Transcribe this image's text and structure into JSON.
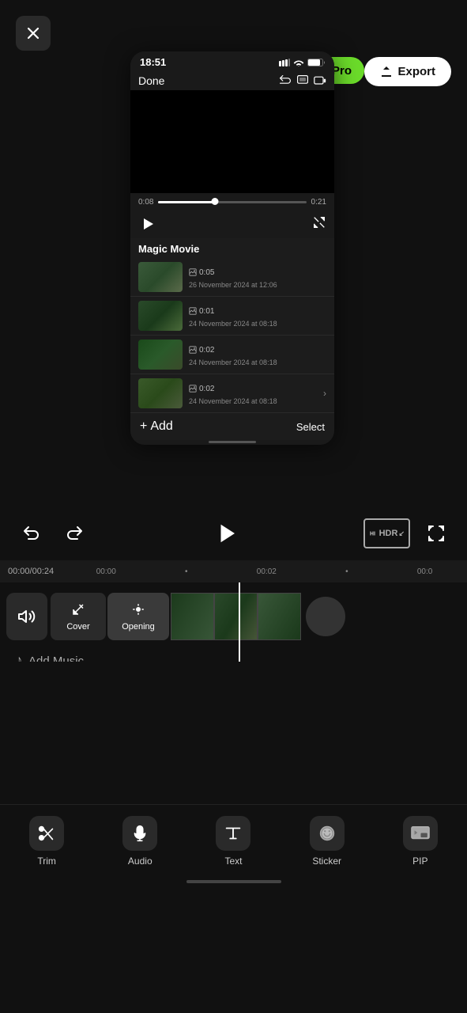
{
  "app": {
    "background": "#111111"
  },
  "close_button": {
    "icon": "✕"
  },
  "export_button": {
    "label": "Export",
    "icon": "↑"
  },
  "pro_badge": {
    "label": "Pro",
    "icon": "◆"
  },
  "phone": {
    "time": "18:51",
    "done_label": "Done",
    "video_duration_start": "0:08",
    "video_duration_end": "0:21",
    "magic_movie_label": "Magic Movie",
    "media_items": [
      {
        "duration": "0:05",
        "date": "26 November 2024 at 12:06",
        "has_arrow": false
      },
      {
        "duration": "0:01",
        "date": "24 November 2024 at 08:18",
        "has_arrow": false
      },
      {
        "duration": "0:02",
        "date": "24 November 2024 at 08:18",
        "has_arrow": false
      },
      {
        "duration": "0:02",
        "date": "24 November 2024 at 08:18",
        "has_arrow": true
      }
    ],
    "add_label": "+ Add",
    "select_label": "Select"
  },
  "controls": {
    "undo_label": "undo",
    "redo_label": "redo",
    "play_label": "play",
    "hdr_label": "HDR",
    "fullscreen_label": "fullscreen"
  },
  "timeline": {
    "current_time": "00:00",
    "total_time": "00:24",
    "markers": [
      "00:00",
      "00:02",
      "00:0"
    ]
  },
  "clips": {
    "cover_label": "Cover",
    "opening_label": "Opening"
  },
  "add_music": {
    "label": "Add Music"
  },
  "toolbar": {
    "items": [
      {
        "label": "Trim",
        "icon": "scissors"
      },
      {
        "label": "Audio",
        "icon": "music"
      },
      {
        "label": "Text",
        "icon": "T"
      },
      {
        "label": "Sticker",
        "icon": "sticker"
      },
      {
        "label": "PIP",
        "icon": "pip"
      }
    ]
  }
}
